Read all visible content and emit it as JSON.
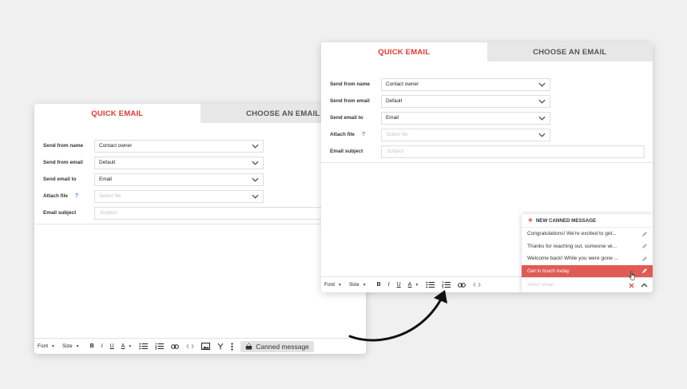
{
  "left_panel": {
    "tabs": [
      "QUICK EMAIL",
      "CHOOSE AN EMAIL"
    ],
    "fields": [
      {
        "label": "Send from name",
        "value": "Contact owner"
      },
      {
        "label": "Send from email",
        "value": "Default"
      },
      {
        "label": "Send email to",
        "value": "Email"
      },
      {
        "label": "Attach file",
        "placeholder": "Select file",
        "help": "?"
      }
    ],
    "subject": {
      "label": "Email subject",
      "placeholder": "Subject"
    },
    "toolbar": {
      "font": "Font",
      "size": "Size",
      "bold": "B",
      "italic": "I",
      "underline": "U",
      "text_color": "A",
      "canned_label": "Canned message"
    }
  },
  "right_panel": {
    "tabs": [
      "QUICK EMAIL",
      "CHOOSE AN EMAIL"
    ],
    "fields": [
      {
        "label": "Send from name",
        "value": "Contact owner"
      },
      {
        "label": "Send from email",
        "value": "Default"
      },
      {
        "label": "Send email to",
        "value": "Email"
      },
      {
        "label": "Attach file",
        "placeholder": "Select file",
        "help": "?"
      }
    ],
    "subject": {
      "label": "Email subject",
      "placeholder": "Subject"
    },
    "toolbar": {
      "font": "Font",
      "size": "Size",
      "bold": "B",
      "italic": "I",
      "underline": "U",
      "text_color": "A"
    },
    "canned_menu": {
      "new_label": "NEW CANNED MESSAGE",
      "items": [
        "Congratulations! We're excited to get...",
        "Thanks for reaching out, someone wi...",
        "Welcome back! While you were gone ...",
        "Get in touch today"
      ],
      "selected_index": 3,
      "search_placeholder": "Select email..."
    }
  },
  "colors": {
    "accent": "#e03a2f",
    "selected_item": "#e05a56",
    "help": "#3a8ee6"
  }
}
